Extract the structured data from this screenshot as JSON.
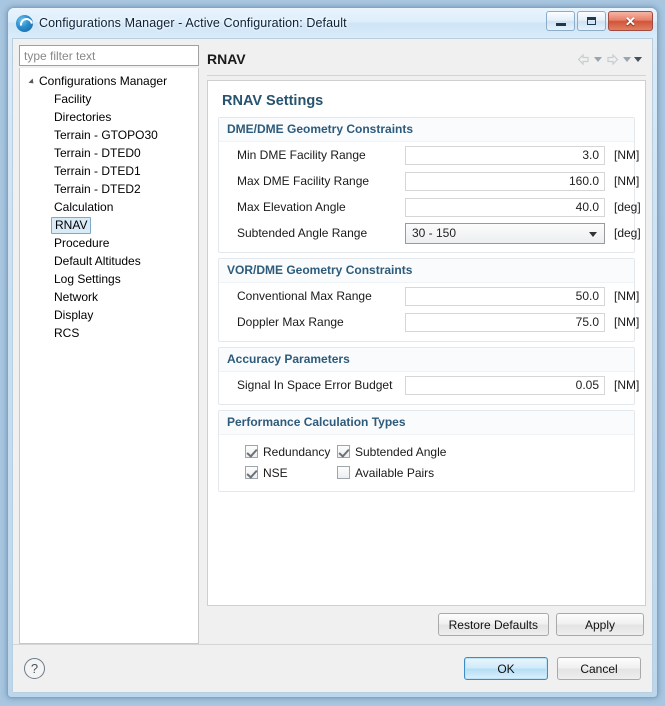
{
  "window": {
    "title": "Configurations Manager - Active Configuration: Default",
    "icon": "app-swirl-icon",
    "controls": {
      "minimize": "minimize-icon",
      "maximize": "maximize-icon",
      "close": "✕"
    }
  },
  "sidebar": {
    "filter": {
      "placeholder": "type filter text",
      "value": ""
    },
    "root": {
      "label": "Configurations Manager",
      "expanded": true
    },
    "items": [
      {
        "label": "Facility",
        "selected": false
      },
      {
        "label": "Directories",
        "selected": false
      },
      {
        "label": "Terrain - GTOPO30",
        "selected": false
      },
      {
        "label": "Terrain - DTED0",
        "selected": false
      },
      {
        "label": "Terrain - DTED1",
        "selected": false
      },
      {
        "label": "Terrain - DTED2",
        "selected": false
      },
      {
        "label": "Calculation",
        "selected": false
      },
      {
        "label": "RNAV",
        "selected": true
      },
      {
        "label": "Procedure",
        "selected": false
      },
      {
        "label": "Default Altitudes",
        "selected": false
      },
      {
        "label": "Log Settings",
        "selected": false
      },
      {
        "label": "Network",
        "selected": false
      },
      {
        "label": "Display",
        "selected": false
      },
      {
        "label": "RCS",
        "selected": false
      }
    ]
  },
  "page": {
    "breadcrumb": "RNAV",
    "nav": {
      "back": "back-arrow-icon",
      "back_menu": "chevron-down-icon",
      "forward": "forward-arrow-icon",
      "forward_menu": "chevron-down-icon",
      "view_menu": "chevron-down-icon"
    },
    "title": "RNAV Settings",
    "groups": [
      {
        "title": "DME/DME Geometry Constraints",
        "fields": [
          {
            "label": "Min DME Facility Range",
            "value": "3.0",
            "unit": "[NM]",
            "type": "text"
          },
          {
            "label": "Max DME Facility Range",
            "value": "160.0",
            "unit": "[NM]",
            "type": "text"
          },
          {
            "label": "Max Elevation Angle",
            "value": "40.0",
            "unit": "[deg]",
            "type": "text"
          },
          {
            "label": "Subtended Angle Range",
            "value": "30 - 150",
            "unit": "[deg]",
            "type": "combo"
          }
        ]
      },
      {
        "title": "VOR/DME Geometry Constraints",
        "fields": [
          {
            "label": "Conventional Max Range",
            "value": "50.0",
            "unit": "[NM]",
            "type": "text"
          },
          {
            "label": "Doppler Max Range",
            "value": "75.0",
            "unit": "[NM]",
            "type": "text"
          }
        ]
      },
      {
        "title": "Accuracy Parameters",
        "fields": [
          {
            "label": "Signal In Space Error Budget",
            "value": "0.05",
            "unit": "[NM]",
            "type": "text"
          }
        ]
      }
    ],
    "performance": {
      "title": "Performance Calculation Types",
      "checkboxes": [
        {
          "label": "Redundancy",
          "checked": true
        },
        {
          "label": "Subtended Angle",
          "checked": true
        },
        {
          "label": "NSE",
          "checked": true
        },
        {
          "label": "Available Pairs",
          "checked": false
        }
      ]
    },
    "actions": {
      "restore_defaults": "Restore Defaults",
      "apply": "Apply"
    }
  },
  "footer": {
    "help": "?",
    "ok": "OK",
    "cancel": "Cancel"
  },
  "colors": {
    "title_blue": "#27536f",
    "group_blue": "#2d5b7c",
    "selection": "#d9ebf7",
    "close_red": "#d1543a"
  }
}
